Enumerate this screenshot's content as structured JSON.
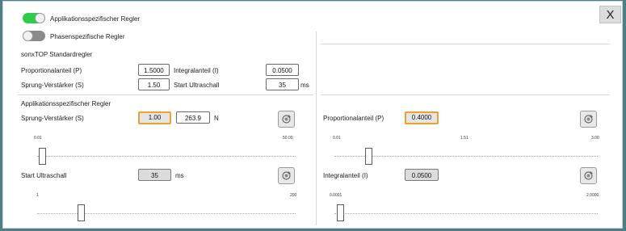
{
  "toggles": {
    "app": {
      "label": "Applikationsspezifischer Regler",
      "on": true
    },
    "phase": {
      "label": "Phasenspezifische Regler",
      "on": false
    }
  },
  "close_label": "X",
  "standard": {
    "title": "sonxTOP Standardregler",
    "p_label": "Proportionalanteil (P)",
    "p_value": "1.5000",
    "i_label": "Integralanteil (I)",
    "i_value": "0.0500",
    "s_label": "Sprung-Verstärker (S)",
    "s_value": "1.50",
    "u_label": "Start Ultraschall",
    "u_value": "35",
    "u_unit": "ms"
  },
  "app": {
    "title": "Applikationsspezifischer Regler",
    "sprung": {
      "label": "Sprung-Verstärker (S)",
      "value": "1.00",
      "force": "263.9",
      "force_unit": "N",
      "min": "0.01",
      "max": "50.00",
      "fraction": 0.02
    },
    "start": {
      "label": "Start Ultraschall",
      "value": "35",
      "unit": "ms",
      "min": "1",
      "max": "200",
      "fraction": 0.17
    }
  },
  "right": {
    "p": {
      "label": "Proportionalanteil (P)",
      "value": "0.4000",
      "min": "0.01",
      "mid": "1.51",
      "max": "3.00",
      "fraction": 0.13
    },
    "i": {
      "label": "Integralanteil (I)",
      "value": "0.0500",
      "min": "0.0001",
      "max": "2.0000",
      "fraction": 0.02
    }
  },
  "colors": {
    "toggle_on": "#2ecc4a",
    "toggle_off": "#8a8a8a",
    "focus": "#f0a030",
    "background": "#4f7f86"
  },
  "icons": {
    "reset": "reset-icon",
    "close": "close-icon"
  }
}
